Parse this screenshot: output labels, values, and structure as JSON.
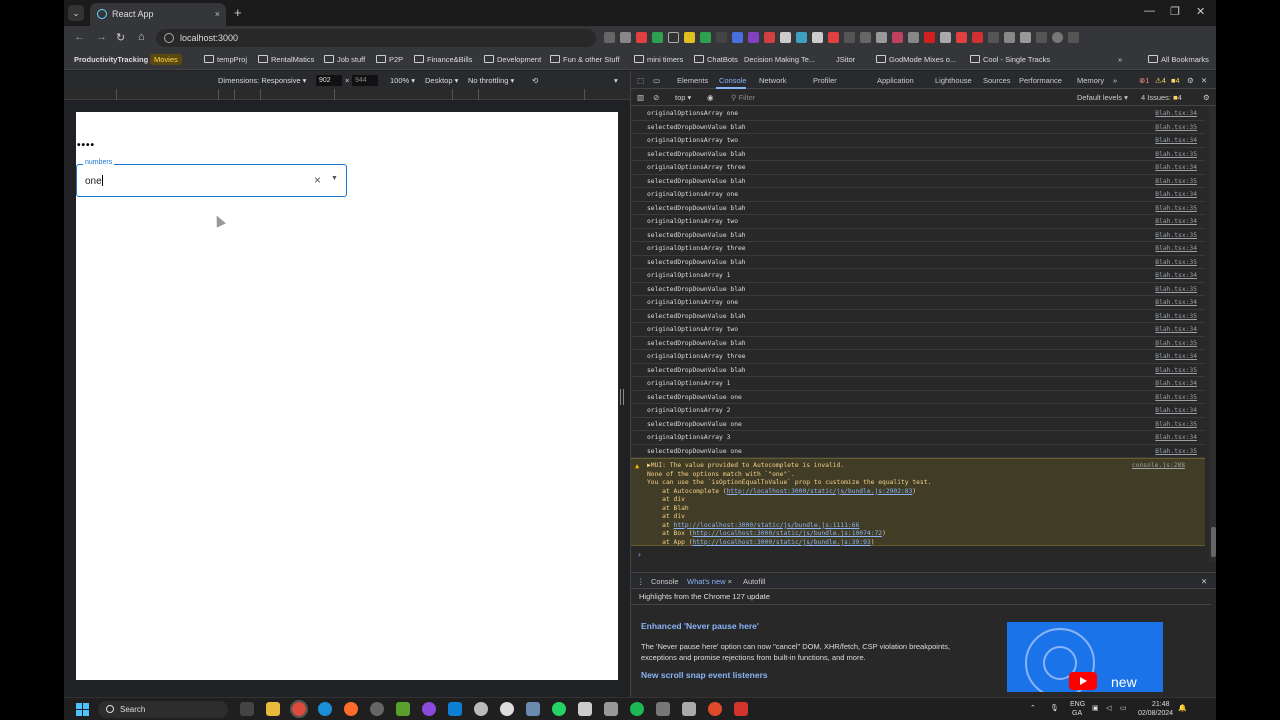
{
  "browser": {
    "tab_title": "React App",
    "url": "localhost:3000",
    "bookmarks": [
      "ProductivityTracking",
      "Movies",
      "tempProj",
      "RentalMatics",
      "Job stuff",
      "P2P",
      "Finance&Bills",
      "Development",
      "Fun & other Stuff",
      "mini timers",
      "ChatBots",
      "Decision Making Te...",
      "JSitor",
      "GodMode Mixes o...",
      "Cool - Single Tracks",
      "All Bookmarks"
    ]
  },
  "device_toolbar": {
    "dimensions_label": "Dimensions: Responsive",
    "width": "902",
    "height": "944",
    "zoom": "100%",
    "device": "Desktop",
    "throttle": "No throttling"
  },
  "app": {
    "dots": "••••",
    "autocomplete": {
      "label": "numbers",
      "value": "one",
      "clear_icon": "close-icon",
      "dropdown_icon": "arrow-drop-down-icon"
    }
  },
  "devtools": {
    "tabs": [
      "Elements",
      "Console",
      "Network",
      "Profiler",
      "Application",
      "Lighthouse",
      "Sources",
      "Performance",
      "Memory"
    ],
    "active_tab": "Console",
    "error_count": "1",
    "warning_count": "4",
    "info_count": "4",
    "context": "top",
    "filter_placeholder": "Filter",
    "levels": "Default levels",
    "issues": "4 Issues:",
    "issues_count": "4",
    "log": [
      {
        "msg": "originalOptionsArray one",
        "src": "Blah.tsx:34"
      },
      {
        "msg": "selectedDropDownValue blah",
        "src": "Blah.tsx:35"
      },
      {
        "msg": "originalOptionsArray two",
        "src": "Blah.tsx:34"
      },
      {
        "msg": "selectedDropDownValue blah",
        "src": "Blah.tsx:35"
      },
      {
        "msg": "originalOptionsArray three",
        "src": "Blah.tsx:34"
      },
      {
        "msg": "selectedDropDownValue blah",
        "src": "Blah.tsx:35"
      },
      {
        "msg": "originalOptionsArray one",
        "src": "Blah.tsx:34"
      },
      {
        "msg": "selectedDropDownValue blah",
        "src": "Blah.tsx:35"
      },
      {
        "msg": "originalOptionsArray two",
        "src": "Blah.tsx:34"
      },
      {
        "msg": "selectedDropDownValue blah",
        "src": "Blah.tsx:35"
      },
      {
        "msg": "originalOptionsArray three",
        "src": "Blah.tsx:34"
      },
      {
        "msg": "selectedDropDownValue blah",
        "src": "Blah.tsx:35"
      },
      {
        "msg": "originalOptionsArray 1",
        "src": "Blah.tsx:34"
      },
      {
        "msg": "selectedDropDownValue blah",
        "src": "Blah.tsx:35"
      },
      {
        "msg": "originalOptionsArray one",
        "src": "Blah.tsx:34"
      },
      {
        "msg": "selectedDropDownValue blah",
        "src": "Blah.tsx:35"
      },
      {
        "msg": "originalOptionsArray two",
        "src": "Blah.tsx:34"
      },
      {
        "msg": "selectedDropDownValue blah",
        "src": "Blah.tsx:35"
      },
      {
        "msg": "originalOptionsArray three",
        "src": "Blah.tsx:34"
      },
      {
        "msg": "selectedDropDownValue blah",
        "src": "Blah.tsx:35"
      },
      {
        "msg": "originalOptionsArray 1",
        "src": "Blah.tsx:34"
      },
      {
        "msg": "selectedDropDownValue one",
        "src": "Blah.tsx:35"
      },
      {
        "msg": "originalOptionsArray 2",
        "src": "Blah.tsx:34"
      },
      {
        "msg": "selectedDropDownValue one",
        "src": "Blah.tsx:35"
      },
      {
        "msg": "originalOptionsArray 3",
        "src": "Blah.tsx:34"
      },
      {
        "msg": "selectedDropDownValue one",
        "src": "Blah.tsx:35"
      }
    ],
    "warning": {
      "line1": "▶MUI: The value provided to Autocomplete is invalid.",
      "line2": "None of the options match with `\"one\"`.",
      "line3": "You can use the `isOptionEqualToValue` prop to customize the equality test.",
      "line4_prefix": "    at Autocomplete (",
      "line4_link": "http://localhost:3000/static/js/bundle.js:2902:83",
      "line5": "    at div",
      "line6": "    at Blah",
      "line7": "    at div",
      "line8_prefix": "    at ",
      "line8_link": "http://localhost:3000/static/js/bundle.js:1111:66",
      "line9_prefix": "    at Box (",
      "line9_link": "http://localhost:3000/static/js/bundle.js:10074:72",
      "line10_prefix": "    at App (",
      "line10_link": "http://localhost:3000/static/js/bundle.js:39:93",
      "src": "console.js:288"
    },
    "drawer_tabs": [
      "Console",
      "What's new",
      "Autofill"
    ],
    "drawer_title": "Highlights from the Chrome 127 update",
    "whats_new": {
      "h1": "Enhanced 'Never pause here'",
      "p1": "The 'Never pause here' option can now \"cancel\" DOM, XHR/fetch, CSP violation breakpoints, exceptions and promise rejections from built-in functions, and more.",
      "h2": "New scroll snap event listeners",
      "thumb_text": "new"
    }
  },
  "taskbar": {
    "search": "Search",
    "lang": "ENG",
    "region": "GA",
    "time": "21:48",
    "date": "02/08/2024"
  }
}
